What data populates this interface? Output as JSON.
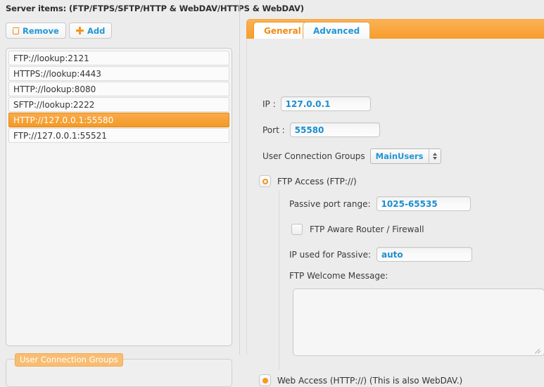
{
  "header": {
    "title": "Server items: (FTP/FTPS/SFTP/HTTP & WebDAV/HTTPS & WebDAV)"
  },
  "toolbar": {
    "remove_label": "Remove",
    "add_label": "Add",
    "remove_icon": "trash-icon",
    "add_icon": "plus-icon"
  },
  "server_list": {
    "items": [
      {
        "label": "FTP://lookup:2121",
        "selected": false
      },
      {
        "label": "HTTPS://lookup:4443",
        "selected": false
      },
      {
        "label": "HTTP://lookup:8080",
        "selected": false
      },
      {
        "label": "SFTP://lookup:2222",
        "selected": false
      },
      {
        "label": "HTTP://127.0.0.1:55580",
        "selected": true
      },
      {
        "label": "FTP://127.0.0.1:55521",
        "selected": false
      }
    ]
  },
  "user_groups_fieldset": {
    "legend": "User Connection Groups"
  },
  "tabs": [
    {
      "label": "General",
      "active": true
    },
    {
      "label": "Advanced",
      "active": false
    }
  ],
  "general": {
    "ip_label": "IP :",
    "ip_value": "127.0.0.1",
    "port_label": "Port :",
    "port_value": "55580",
    "groups_label": "User Connection Groups",
    "groups_value": "MainUsers",
    "ftp_access_label": "FTP Access (FTP://)",
    "ftp_access_state": "collapsed",
    "passive_label": "Passive port range:",
    "passive_value": "1025-65535",
    "aware_label": "FTP Aware Router / Firewall",
    "aware_checked": false,
    "ip_passive_label": "IP used for Passive:",
    "ip_passive_value": "auto",
    "welcome_label": "FTP Welcome Message:",
    "welcome_value": "",
    "web_access_label": "Web Access (HTTP://) (This is also WebDAV.)",
    "web_access_state": "expanded"
  },
  "colors": {
    "accent_orange": "#f59a2e",
    "link_blue": "#2196d6",
    "value_blue": "#1a8fd0",
    "page_bg": "#ececec",
    "selected_row": "#f6a33c"
  }
}
